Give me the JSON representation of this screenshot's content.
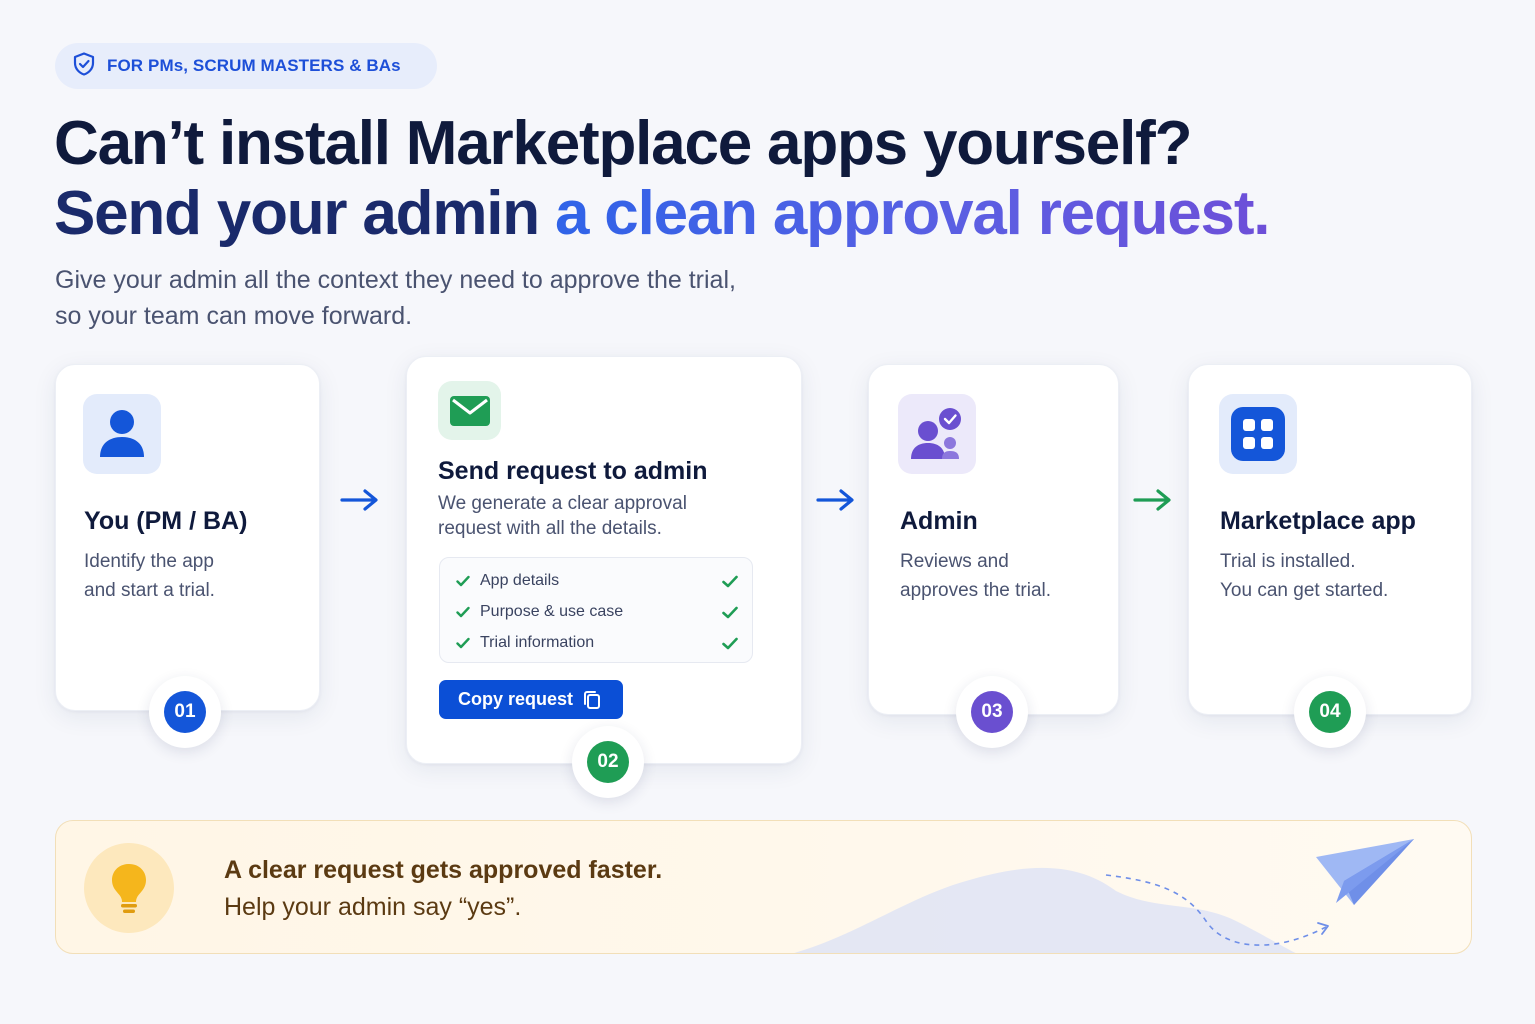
{
  "badge": {
    "text": "FOR PMs, SCRUM MASTERS & BAs",
    "icon": "shield-check-icon"
  },
  "headline": {
    "line1": "Can’t install Marketplace apps yourself?",
    "line2_plain": "Send your admin ",
    "line2_highlight": "a clean approval request."
  },
  "subtitle": {
    "line1": "Give your admin all the context they need to approve the trial,",
    "line2": "so your team can move forward."
  },
  "steps": [
    {
      "number": "01",
      "title": "You (PM / BA)",
      "desc1": "Identify the app",
      "desc2": "and start a trial.",
      "icon": "user-icon",
      "color": "#1456d9"
    },
    {
      "number": "02",
      "title": "Send request to admin",
      "desc1": "We generate a clear approval",
      "desc2": "request with all the details.",
      "icon": "mail-icon",
      "color": "#1f9d55",
      "checklist": [
        "App details",
        "Purpose & use case",
        "Trial information"
      ],
      "button": "Copy request"
    },
    {
      "number": "03",
      "title": "Admin",
      "desc1": "Reviews and",
      "desc2": "approves the trial.",
      "icon": "admin-users-icon",
      "color": "#6a4fd0"
    },
    {
      "number": "04",
      "title": "Marketplace app",
      "desc1": "Trial is installed.",
      "desc2": "You can get started.",
      "icon": "app-grid-icon",
      "color": "#1f9d55"
    }
  ],
  "colors": {
    "blue": "#1456d9",
    "green": "#1f9d55",
    "purple": "#6a4fd0",
    "navy": "#0f1a3c"
  },
  "tip": {
    "title": "A clear request gets approved faster.",
    "subtitle": "Help your admin say “yes”.",
    "icon": "lightbulb-icon"
  }
}
